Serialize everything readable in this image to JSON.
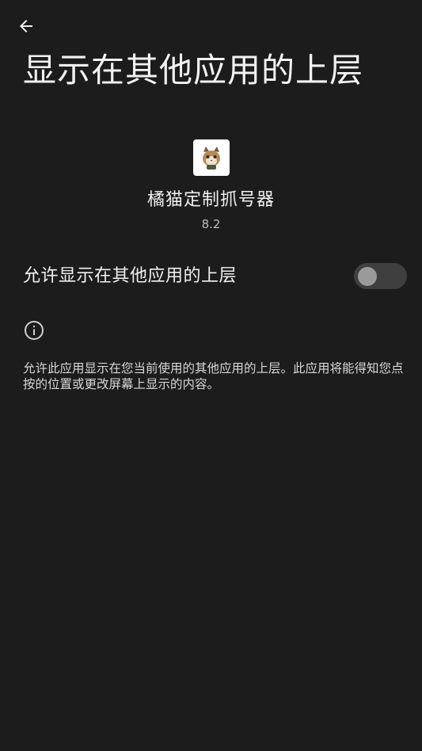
{
  "header": {
    "back_icon": "arrow-back-icon",
    "title": "显示在其他应用的上层"
  },
  "app": {
    "icon": "app-cat-icon",
    "name": "橘猫定制抓号器",
    "version": "8.2"
  },
  "setting": {
    "label": "允许显示在其他应用的上层",
    "enabled": false
  },
  "info": {
    "icon": "info-icon",
    "description": "允许此应用显示在您当前使用的其他应用的上层。此应用将能得知您点按的位置或更改屏幕上显示的内容。"
  },
  "colors": {
    "background": "#1c1c1c",
    "toggle_track_off": "#3f3f3f",
    "toggle_knob_off": "#9a9a9a"
  }
}
